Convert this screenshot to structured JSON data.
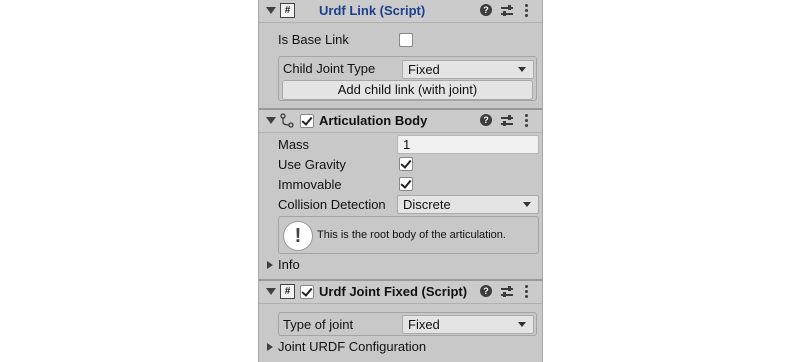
{
  "urdf_link": {
    "title": "Urdf Link (Script)",
    "script_glyph": "#",
    "icons": [
      "help-icon",
      "preset-sliders-icon",
      "kebab-menu-icon"
    ],
    "is_base_link_label": "Is Base Link",
    "is_base_link_checked": false,
    "child_joint_type_label": "Child Joint Type",
    "child_joint_type_value": "Fixed",
    "add_child_button": "Add child link (with joint)"
  },
  "articulation_body": {
    "title": "Articulation Body",
    "enabled": true,
    "icons": [
      "articulation-icon",
      "help-icon",
      "preset-sliders-icon",
      "kebab-menu-icon"
    ],
    "mass_label": "Mass",
    "mass_value": "1",
    "use_gravity_label": "Use Gravity",
    "use_gravity_checked": true,
    "immovable_label": "Immovable",
    "immovable_checked": true,
    "collision_detection_label": "Collision Detection",
    "collision_detection_value": "Discrete",
    "help_box_glyph": "!",
    "help_box_text": "This is the root body of the articulation.",
    "info_label": "Info"
  },
  "urdf_joint_fixed": {
    "title": "Urdf Joint Fixed (Script)",
    "script_glyph": "#",
    "enabled": true,
    "type_of_joint_label": "Type of joint",
    "type_of_joint_value": "Fixed",
    "joint_urdf_config_label": "Joint URDF Configuration"
  },
  "colors": {
    "panel_bg": "#c8c8c8",
    "script_title": "#1b3f8c",
    "field_bg": "#f0f0f0"
  }
}
